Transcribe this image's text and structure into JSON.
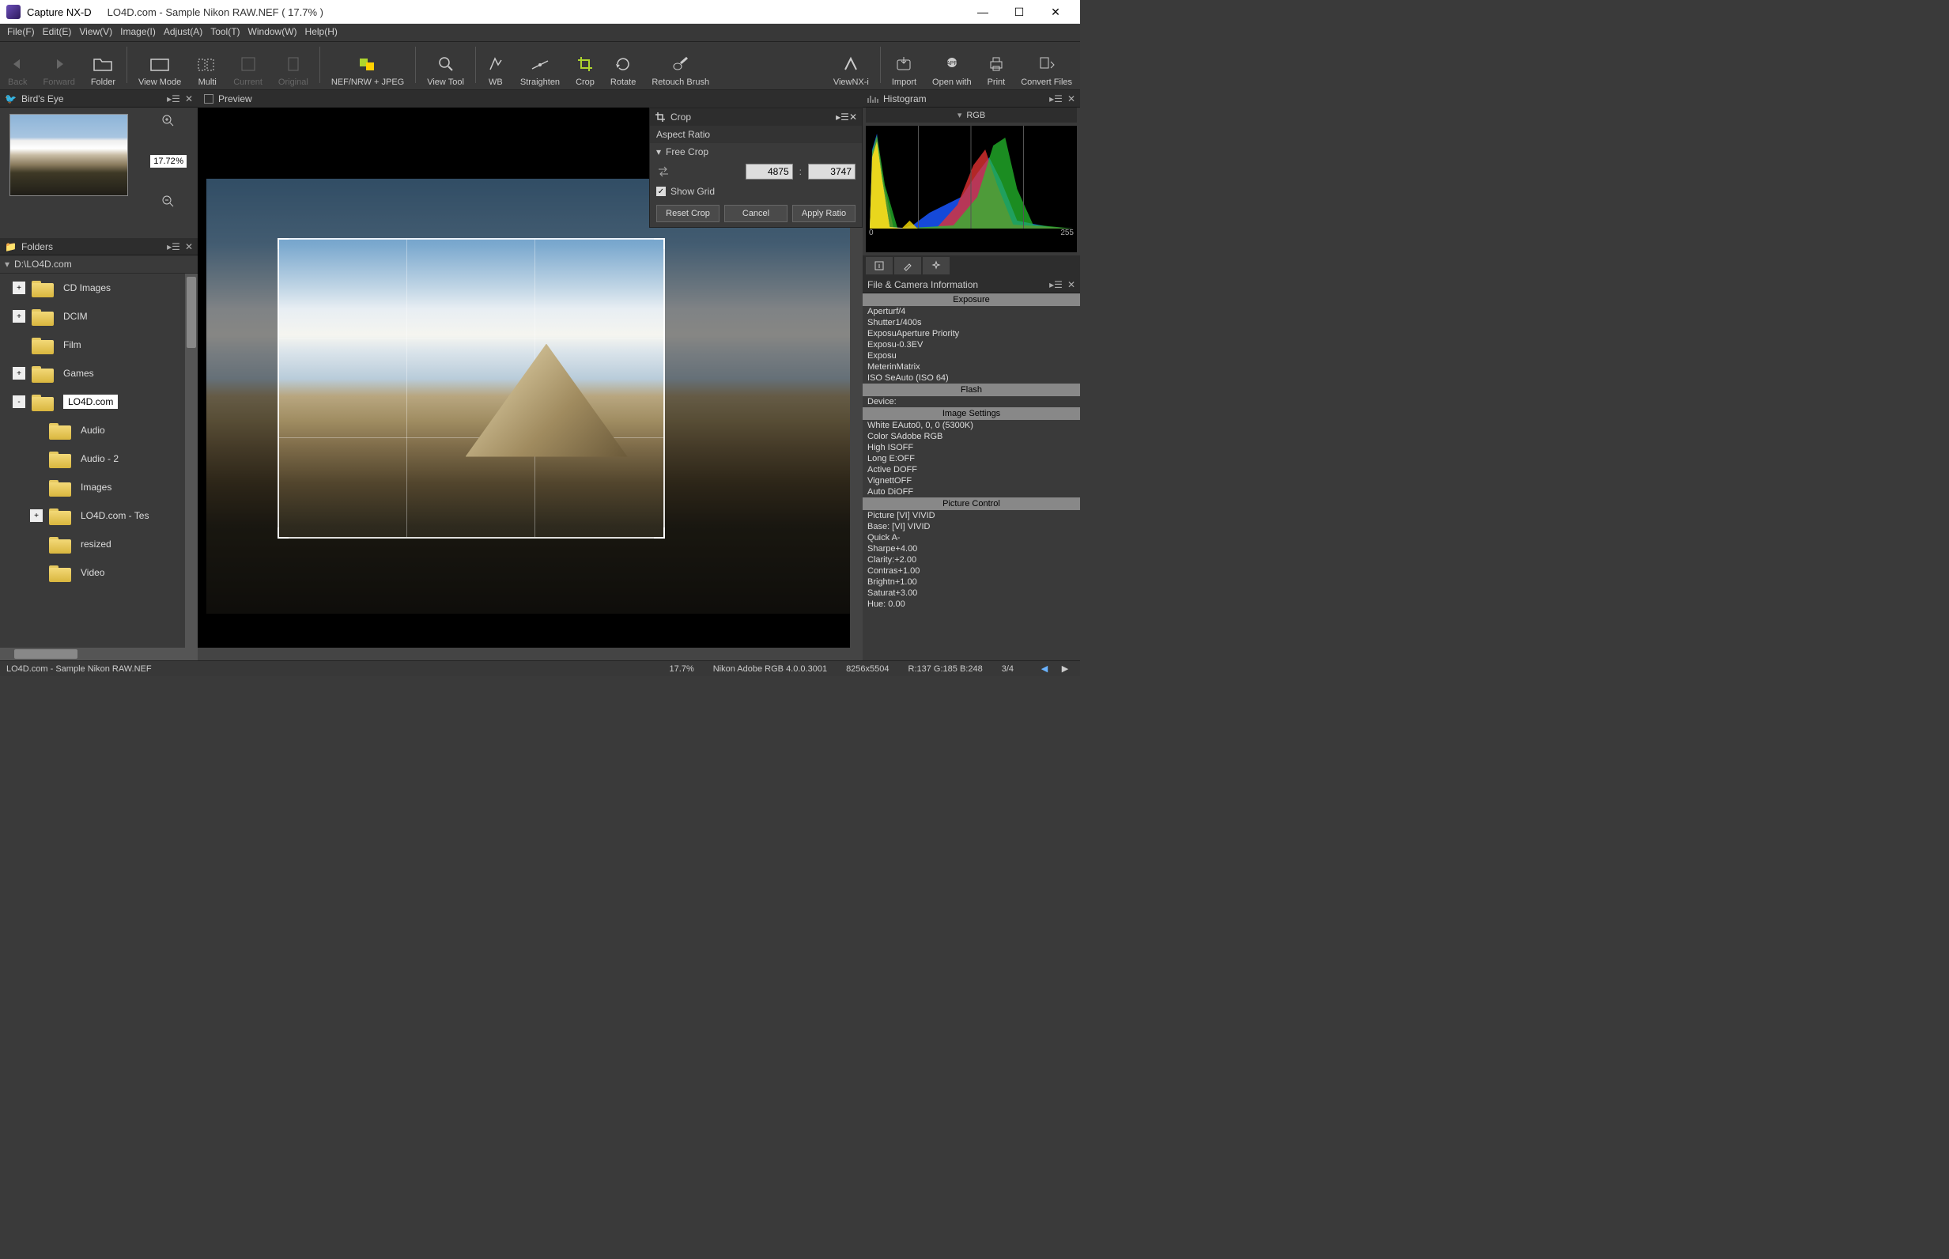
{
  "title": {
    "app": "Capture NX-D",
    "doc": "LO4D.com - Sample Nikon RAW.NEF ( 17.7% )"
  },
  "menu": [
    {
      "l": "File(F)"
    },
    {
      "l": "Edit(E)"
    },
    {
      "l": "View(V)"
    },
    {
      "l": "Image(I)"
    },
    {
      "l": "Adjust(A)"
    },
    {
      "l": "Tool(T)"
    },
    {
      "l": "Window(W)"
    },
    {
      "l": "Help(H)"
    }
  ],
  "tools": {
    "back": "Back",
    "forward": "Forward",
    "folder": "Folder",
    "viewmode": "View Mode",
    "multi": "Multi",
    "current": "Current",
    "original": "Original",
    "nef": "NEF/NRW + JPEG",
    "viewtool": "View Tool",
    "wb": "WB",
    "straighten": "Straighten",
    "crop": "Crop",
    "rotate": "Rotate",
    "retouch": "Retouch Brush",
    "viewnx": "ViewNX-i",
    "import": "Import",
    "openwith": "Open with",
    "print": "Print",
    "convert": "Convert Files"
  },
  "birds": {
    "title": "Bird's Eye",
    "zoom": "17.72",
    "pct": "%"
  },
  "folders": {
    "title": "Folders",
    "path": "D:\\LO4D.com",
    "items": [
      {
        "t": "+",
        "l": "CD Images",
        "d": 1
      },
      {
        "t": "+",
        "l": "DCIM",
        "d": 1
      },
      {
        "t": "",
        "l": "Film",
        "d": 1
      },
      {
        "t": "+",
        "l": "Games",
        "d": 1
      },
      {
        "t": "-",
        "l": "LO4D.com",
        "d": 1,
        "sel": true
      },
      {
        "t": "",
        "l": "Audio",
        "d": 2
      },
      {
        "t": "",
        "l": "Audio - 2",
        "d": 2
      },
      {
        "t": "",
        "l": "Images",
        "d": 2
      },
      {
        "t": "+",
        "l": "LO4D.com - Tes",
        "d": 2
      },
      {
        "t": "",
        "l": "resized",
        "d": 2
      },
      {
        "t": "",
        "l": "Video",
        "d": 2
      }
    ]
  },
  "preview": {
    "title": "Preview"
  },
  "crop": {
    "title": "Crop",
    "aspect": "Aspect Ratio",
    "free": "Free Crop",
    "w": "4875",
    "h": "3747",
    "showgrid": "Show Grid",
    "reset": "Reset Crop",
    "cancel": "Cancel",
    "apply": "Apply Ratio"
  },
  "histo": {
    "title": "Histogram",
    "rgb": "RGB",
    "min": "0",
    "max": "255"
  },
  "fci": {
    "title": "File & Camera Information",
    "sections": [
      {
        "h": "Exposure",
        "rows": [
          "Aperturf/4",
          "Shutter1/400s",
          "ExposuAperture Priority",
          "Exposu-0.3EV",
          "Exposu",
          "MeterinMatrix",
          "ISO SeAuto (ISO 64)"
        ]
      },
      {
        "h": "Flash",
        "rows": [
          "Device:"
        ]
      },
      {
        "h": "Image Settings",
        "rows": [
          "White EAuto0, 0, 0 (5300K)",
          "Color SAdobe RGB",
          "High ISOFF",
          "Long E:OFF",
          "Active DOFF",
          "VignettOFF",
          "Auto DiOFF"
        ]
      },
      {
        "h": "Picture Control",
        "rows": [
          "Picture [VI] VIVID",
          "Base:   [VI] VIVID",
          "Quick A-",
          "Sharpe+4.00",
          "Clarity:+2.00",
          "Contras+1.00",
          "Brightn+1.00",
          "Saturat+3.00",
          "Hue:     0.00"
        ]
      }
    ]
  },
  "status": {
    "file": "LO4D.com - Sample Nikon RAW.NEF",
    "zoom": "17.7%",
    "profile": "Nikon Adobe RGB 4.0.0.3001",
    "dims": "8256x5504",
    "rgb": "R:137 G:185 B:248",
    "count": "3/4"
  }
}
